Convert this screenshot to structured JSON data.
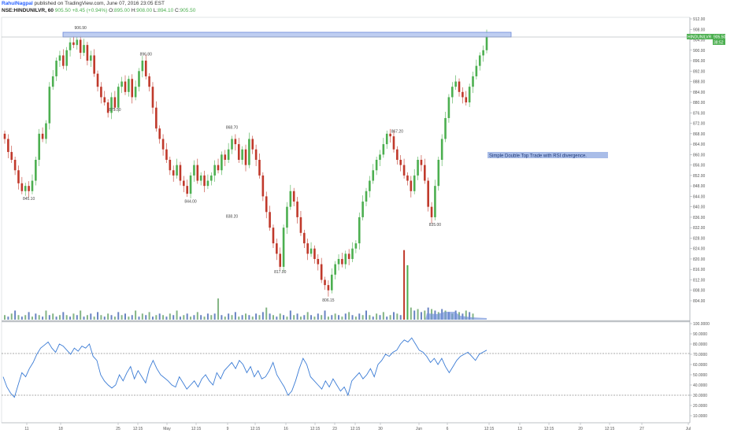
{
  "header": {
    "author": "RahulNagpal",
    "published": "published on TradingView.com, June 07, 2016 23:05 EST",
    "symbol": "NSE:HINDUNILVR, 60",
    "last": "905.50",
    "change": "+8.45 (+0.94%)",
    "open_label": "O:",
    "open": "895.00",
    "high_label": "H:",
    "high": "908.00",
    "low_label": "L:",
    "low": "894.10",
    "close_label": "C:",
    "close": "905.50"
  },
  "colors": {
    "up": "#4caf50",
    "down": "#c0392b",
    "rsi_line": "#3a7bd5",
    "zone_fill": "#b9c9f0",
    "zone_stroke": "#5b7bd5",
    "note_fill": "#a9bde8",
    "price_tag": "#4caf50",
    "volume_area": "#6f8fd8"
  },
  "chart_data": [
    {
      "type": "candlestick",
      "title": "",
      "symbol": "NSE:HINDUNILVR, 60",
      "y_range": [
        902,
        914
      ],
      "y_ticks": [
        "912.00",
        "908.00",
        "904.00",
        "900.00",
        "896.00",
        "892.00",
        "888.00",
        "884.00",
        "880.00",
        "876.00",
        "872.00",
        "868.00",
        "864.00",
        "860.00",
        "856.00",
        "852.00",
        "848.00",
        "844.00",
        "840.00",
        "836.00",
        "832.00",
        "828.00",
        "824.00",
        "820.00",
        "816.00",
        "812.00",
        "808.00",
        "804.00"
      ],
      "x_ticks": [
        "11",
        "18",
        "25",
        "12:15",
        "May",
        "12:15",
        "9",
        "12:15",
        "16",
        "12:15",
        "23",
        "12:15",
        "30",
        "Jun",
        "6",
        "12:15",
        "13",
        "12:15",
        "20",
        "12:15",
        "27",
        "Jul"
      ],
      "price_label": "HINDUNILVR",
      "price_value": "905.50",
      "price_sub": "38:52",
      "swing_labels": [
        {
          "text": "906.90",
          "x_index": 22,
          "price": 906.9
        },
        {
          "text": "896.80",
          "x_index": 41,
          "price": 896.8
        },
        {
          "text": "875.50",
          "x_index": 32,
          "price": 875.5
        },
        {
          "text": "845.10",
          "x_index": 7,
          "price": 845.1
        },
        {
          "text": "844.00",
          "x_index": 54,
          "price": 844.0
        },
        {
          "text": "868.70",
          "x_index": 66,
          "price": 868.7
        },
        {
          "text": "838.20",
          "x_index": 66,
          "price": 838.2
        },
        {
          "text": "817.00",
          "x_index": 80,
          "price": 817.0
        },
        {
          "text": "806.15",
          "x_index": 94,
          "price": 806.15
        },
        {
          "text": "867.20",
          "x_index": 114,
          "price": 867.2
        },
        {
          "text": "835.00",
          "x_index": 125,
          "price": 835.0
        }
      ],
      "resistance_zone": [
        904.5,
        906.9
      ],
      "annotation": "Simple Double Top Trade with RSI divergence.",
      "close_series": [
        866,
        861,
        858,
        854,
        849,
        846,
        848,
        846,
        850,
        858,
        868,
        866,
        872,
        886,
        890,
        896,
        898,
        894,
        900,
        903,
        902,
        904,
        899,
        902,
        896,
        898,
        891,
        886,
        882,
        880,
        876,
        882,
        878,
        886,
        888,
        884,
        889,
        882,
        886,
        892,
        896,
        890,
        886,
        878,
        870,
        866,
        862,
        858,
        854,
        852,
        856,
        850,
        848,
        845,
        852,
        856,
        850,
        852,
        848,
        850,
        852,
        856,
        854,
        860,
        858,
        862,
        866,
        864,
        858,
        862,
        856,
        866,
        862,
        858,
        852,
        844,
        838,
        832,
        826,
        822,
        817,
        832,
        840,
        846,
        842,
        836,
        830,
        826,
        822,
        824,
        820,
        818,
        812,
        810,
        808,
        814,
        818,
        820,
        818,
        822,
        820,
        824,
        826,
        836,
        842,
        846,
        850,
        854,
        858,
        860,
        864,
        868,
        867,
        862,
        858,
        856,
        852,
        850,
        846,
        852,
        858,
        856,
        850,
        840,
        836,
        848,
        858,
        866,
        874,
        882,
        886,
        888,
        884,
        882,
        880,
        886,
        890,
        894,
        898,
        900,
        905.5
      ]
    },
    {
      "type": "line",
      "title": "",
      "indicator": "RSI",
      "y_ticks": [
        "100.0000",
        "90.0000",
        "80.0000",
        "70.0000",
        "60.0000",
        "50.0000",
        "40.0000",
        "30.0000",
        "20.0000",
        "10.0000"
      ],
      "bands": [
        70,
        30
      ],
      "values": [
        48,
        38,
        32,
        28,
        40,
        52,
        48,
        56,
        62,
        70,
        76,
        79,
        82,
        76,
        72,
        80,
        78,
        74,
        70,
        76,
        73,
        78,
        76,
        80,
        68,
        64,
        50,
        44,
        40,
        37,
        40,
        50,
        44,
        52,
        58,
        46,
        54,
        48,
        42,
        56,
        64,
        56,
        50,
        47,
        44,
        40,
        38,
        48,
        42,
        36,
        40,
        44,
        38,
        46,
        50,
        44,
        40,
        52,
        46,
        54,
        58,
        62,
        56,
        64,
        60,
        52,
        58,
        48,
        54,
        46,
        48,
        54,
        62,
        50,
        44,
        38,
        30,
        34,
        44,
        56,
        66,
        60,
        48,
        44,
        40,
        36,
        44,
        38,
        46,
        40,
        34,
        38,
        30,
        44,
        48,
        52,
        46,
        50,
        56,
        48,
        60,
        64,
        70,
        68,
        72,
        74,
        80,
        84,
        82,
        86,
        80,
        74,
        72,
        68,
        62,
        66,
        60,
        66,
        58,
        52,
        58,
        64,
        68,
        70,
        72,
        68,
        64,
        70,
        72,
        74
      ]
    },
    {
      "type": "bar",
      "title": "",
      "name": "volume",
      "values": [
        3,
        2,
        4,
        6,
        3,
        2,
        3,
        5,
        2,
        4,
        3,
        2,
        6,
        3,
        4,
        2,
        3,
        5,
        3,
        2,
        4,
        3,
        6,
        2,
        3,
        4,
        2,
        5,
        3,
        2,
        4,
        3,
        2,
        5,
        3,
        4,
        2,
        3,
        6,
        2,
        4,
        3,
        5,
        2,
        3,
        4,
        3,
        2,
        4,
        3,
        6,
        2,
        3,
        4,
        2,
        3,
        5,
        3,
        2,
        4,
        3,
        4,
        14,
        3,
        2,
        4,
        3,
        5,
        2,
        3,
        4,
        3,
        2,
        4,
        3,
        5,
        8,
        4,
        3,
        2,
        4,
        3,
        2,
        6,
        3,
        4,
        2,
        3,
        5,
        3,
        2,
        4,
        3,
        6,
        2,
        3,
        4,
        3,
        2,
        4,
        5,
        3,
        2,
        4,
        3,
        6,
        3,
        2,
        4,
        3,
        5,
        2,
        3,
        5,
        4,
        3,
        46,
        36,
        8,
        6,
        7,
        5,
        6,
        8,
        7,
        6,
        5,
        7,
        6,
        5,
        4,
        6,
        5,
        4,
        6,
        5,
        4
      ],
      "highlight_bars": [
        116,
        117
      ]
    }
  ]
}
